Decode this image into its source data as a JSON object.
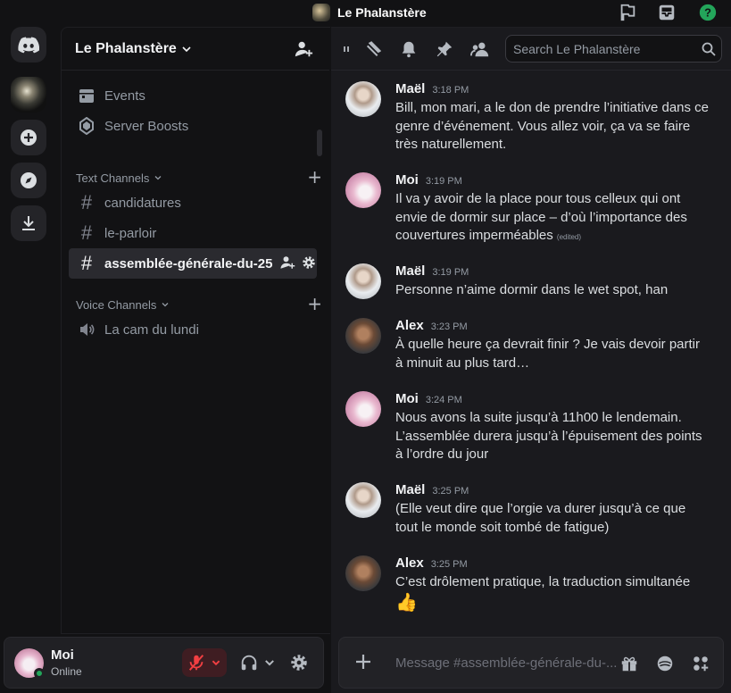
{
  "window": {
    "title": "Le Phalanstère",
    "icons": [
      "server-avatar",
      "flag-icon",
      "inbox-icon",
      "help-icon"
    ]
  },
  "rail": {
    "items": [
      "discord-home",
      "server-le-phalanstere",
      "add-server",
      "discover",
      "download-apps"
    ]
  },
  "server": {
    "name": "Le Phalanstère"
  },
  "sidebar": {
    "top_items": [
      {
        "label": "Events",
        "icon": "calendar-icon"
      },
      {
        "label": "Server Boosts",
        "icon": "boost-gem-icon"
      }
    ],
    "text_category": "Text Channels",
    "text_channels": [
      {
        "label": "candidatures",
        "active": false
      },
      {
        "label": "le-parloir",
        "active": false
      },
      {
        "label": "assemblée-générale-du-25",
        "active": true
      }
    ],
    "voice_category": "Voice Channels",
    "voice_channels": [
      {
        "label": "La cam du lundi",
        "icon": "voice-speaker-icon"
      }
    ]
  },
  "user": {
    "name": "Moi",
    "status": "Online",
    "status_color": "#23a55a",
    "mic_muted": true
  },
  "chat": {
    "search_placeholder": "Search Le Phalanstère",
    "composer_placeholder": "Message #assemblée-générale-du-...",
    "messages": [
      {
        "author": "Maël",
        "time": "3:18 PM",
        "avatar": "mael",
        "text": "Bill, mon mari, a le don de prendre l’initiative dans ce genre d’événement. Vous allez voir, ça va se faire très naturellement."
      },
      {
        "author": "Moi",
        "time": "3:19 PM",
        "avatar": "moi",
        "text": "Il va y avoir de la place pour tous celleux qui ont envie de dormir sur place – d’où l’importance des couvertures imperméables",
        "edited": "(edited)"
      },
      {
        "author": "Maël",
        "time": "3:19 PM",
        "avatar": "mael",
        "text": "Personne n’aime dormir dans le wet spot, han"
      },
      {
        "author": "Alex",
        "time": "3:23 PM",
        "avatar": "alex",
        "text": "À quelle heure ça devrait finir ? Je vais devoir partir à minuit au plus tard…"
      },
      {
        "author": "Moi",
        "time": "3:24 PM",
        "avatar": "moi",
        "text": "Nous avons la suite jusqu’à 11h00 le lendemain. L’assemblée durera jusqu’à l’épuisement des points à l’ordre du jour"
      },
      {
        "author": "Maël",
        "time": "3:25 PM",
        "avatar": "mael",
        "text": "(Elle veut dire que l’orgie va durer jusqu’à ce que tout le monde soit tombé de fatigue)"
      },
      {
        "author": "Alex",
        "time": "3:25 PM",
        "avatar": "alex",
        "text": "C’est drôlement pratique, la traduction simultanée",
        "emoji": "👍"
      }
    ]
  },
  "colors": {
    "accent_green": "#23a55a",
    "mute_red": "#f23f42",
    "help_green": "#23a55a"
  }
}
